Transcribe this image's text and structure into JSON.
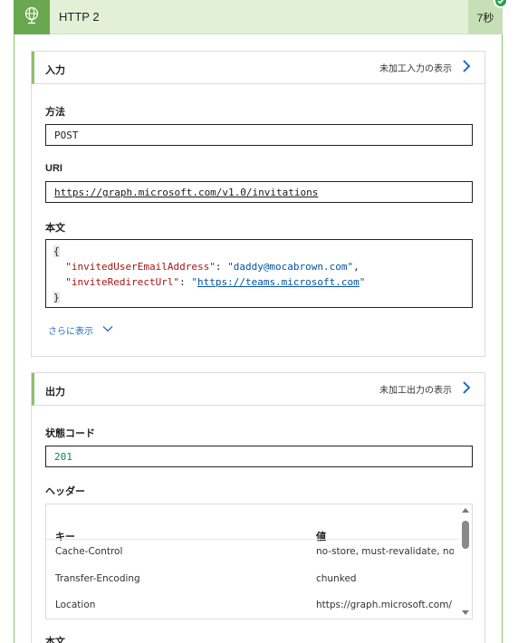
{
  "header": {
    "title": "HTTP 2",
    "duration": "7秒",
    "icon": "globe-icon",
    "status_icon": "check-circle-icon",
    "accent_color": "#6aa84f",
    "success_color": "#2e9e4f"
  },
  "input_section": {
    "title": "入力",
    "raw_link": "未加工入力の表示",
    "method_label": "方法",
    "method_value": "POST",
    "uri_label": "URI",
    "uri_value": "https://graph.microsoft.com/v1.0/invitations",
    "body_label": "本文",
    "body": {
      "open_brace": "{",
      "key1": "\"invitedUserEmailAddress\"",
      "value1": "\"daddy@mocabrown.com\"",
      "key2": "\"inviteRedirectUrl\"",
      "value2_url": "https://teams.microsoft.com",
      "close_brace": "}"
    },
    "show_more": "さらに表示"
  },
  "output_section": {
    "title": "出力",
    "raw_link": "未加工出力の表示",
    "status_label": "状態コード",
    "status_value": "201",
    "headers_label": "ヘッダー",
    "headers_columns": {
      "key": "キー",
      "value": "値"
    },
    "headers_rows": [
      {
        "key": "Cache-Control",
        "value": "no-store, must-revalidate, no-..."
      },
      {
        "key": "Transfer-Encoding",
        "value": "chunked"
      },
      {
        "key": "Location",
        "value": "https://graph.microsoft.com/"
      }
    ],
    "body_label": "本文"
  }
}
